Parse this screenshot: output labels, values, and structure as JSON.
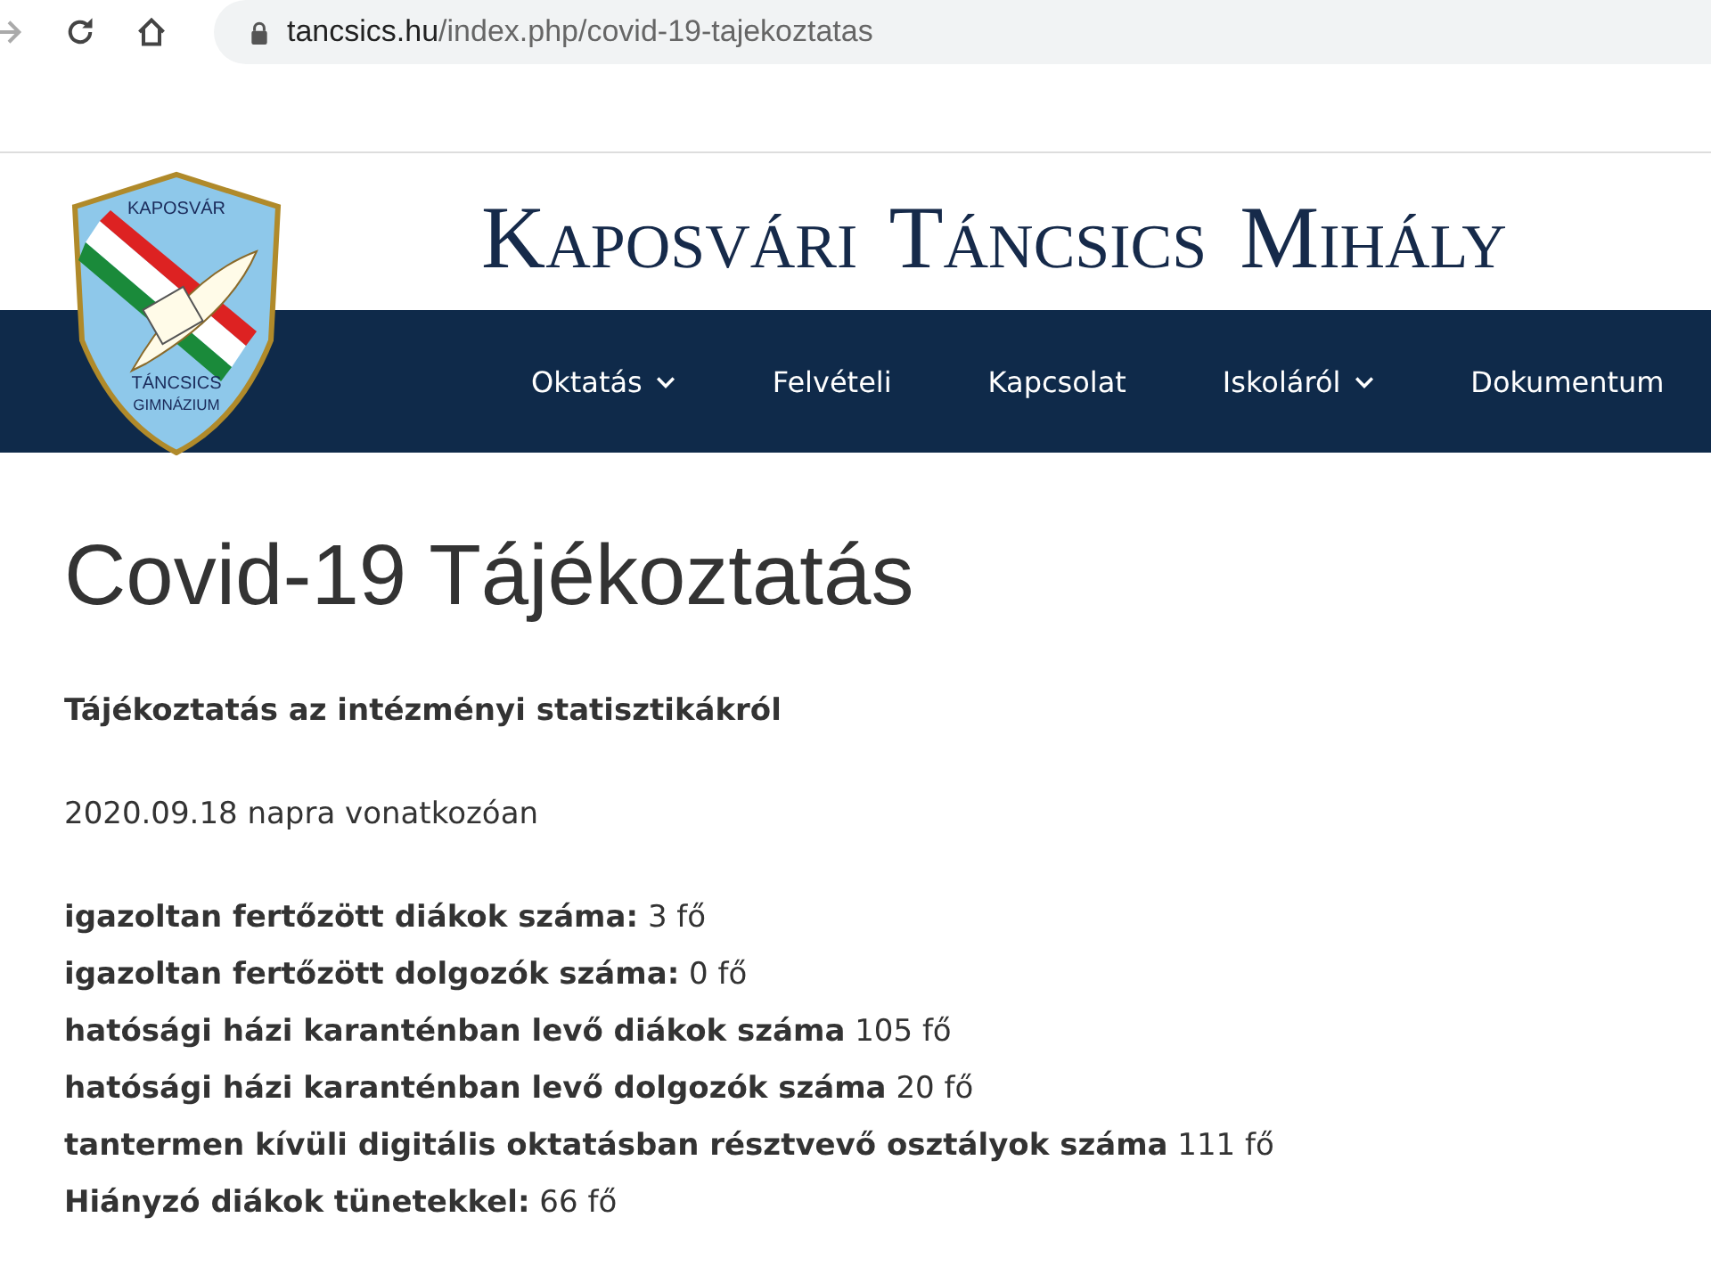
{
  "browser": {
    "url_host": "tancsics.hu",
    "url_path": "/index.php/covid-19-tajekoztatas"
  },
  "logo": {
    "top_text": "KAPOSVÁR",
    "bottom_text_1": "TÁNCSICS",
    "bottom_text_2": "GIMNÁZIUM"
  },
  "site_title": "Kaposvári Táncsics Mihály",
  "nav": [
    {
      "label": "Oktatás",
      "has_dropdown": true
    },
    {
      "label": "Felvételi",
      "has_dropdown": false
    },
    {
      "label": "Kapcsolat",
      "has_dropdown": false
    },
    {
      "label": "Iskoláról",
      "has_dropdown": true
    },
    {
      "label": "Dokumentum",
      "has_dropdown": false
    }
  ],
  "page_title": "Covid-19 Tájékoztatás",
  "subtitle": "Tájékoztatás az intézményi statisztikákról",
  "date_line": "2020.09.18 napra vonatkozóan",
  "stats": [
    "**igazoltan fertőzött diákok száma:** 3 fő",
    "**igazoltan fertőzött dolgozók száma:** 0 fő",
    "**hatósági házi karanténban levő diákok száma** 105 fő",
    "**hatósági házi karanténban levő dolgozók száma** 20 fő",
    "**tantermen kívüli digitális oktatásban résztvevő osztályok száma** 111 fő",
    "**Hiányzó diákok tünetekkel:** 66 fő"
  ]
}
